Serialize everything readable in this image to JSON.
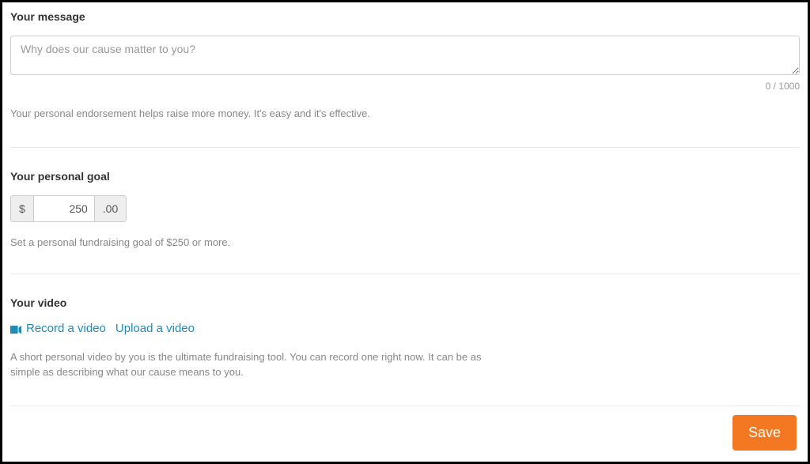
{
  "message": {
    "title": "Your message",
    "placeholder": "Why does our cause matter to you?",
    "value": "",
    "counter": "0 / 1000",
    "help": "Your personal endorsement helps raise more money. It's easy and it's effective."
  },
  "goal": {
    "title": "Your personal goal",
    "currency": "$",
    "value": "250",
    "cents": ".00",
    "help": "Set a personal fundraising goal of $250 or more."
  },
  "video": {
    "title": "Your video",
    "record_label": "Record a video",
    "upload_label": "Upload a video",
    "help": "A short personal video by you is the ultimate fundraising tool. You can record one right now. It can be as simple as describing what our cause means to you."
  },
  "footer": {
    "save_label": "Save"
  }
}
